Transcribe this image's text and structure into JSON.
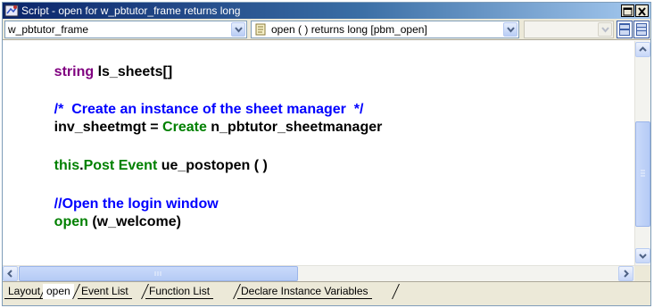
{
  "window": {
    "title": "Script - open for w_pbtutor_frame returns long"
  },
  "selectors": {
    "object_value": "w_pbtutor_frame",
    "event_value": "open ( )  returns long [pbm_open]",
    "ancestor_value": ""
  },
  "code": {
    "line1": {
      "type": "string",
      "rest": " ls_sheets[]"
    },
    "line2": {
      "comment": "/*  Create an instance of the sheet manager  */"
    },
    "line3": {
      "lhs": "inv_sheetmgt = ",
      "kw": "Create",
      "rest": " n_pbtutor_sheetmanager"
    },
    "line4": {
      "this": "this",
      "dot": ".",
      "kw": "Post Event",
      "rest": " ue_postopen ( )"
    },
    "line5": {
      "comment": "//Open the login window"
    },
    "line6": {
      "kw": "open",
      "rest": " (w_welcome)"
    }
  },
  "tabs": {
    "layout": "Layout",
    "open": "open",
    "events": "Event List",
    "functions": "Function List",
    "declare": "Declare Instance Variables"
  },
  "colors": {
    "keyword_type": "#800080",
    "keyword_function": "#008000",
    "comment": "#0000ff",
    "title_bar": "#0a246a"
  }
}
